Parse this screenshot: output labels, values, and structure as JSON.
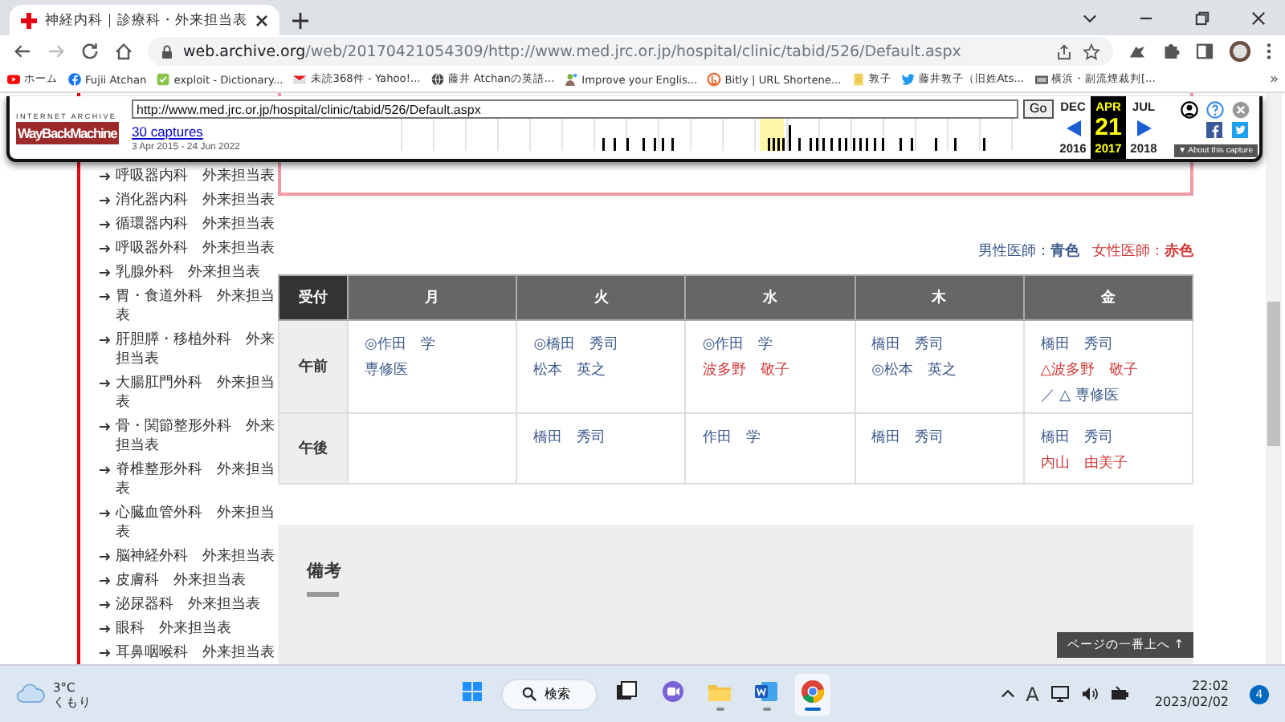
{
  "browser": {
    "tab": {
      "title": "神経内科｜診療科・外来担当表"
    },
    "address": {
      "host": "web.archive.org",
      "path": "/web/20170421054309/http://www.med.jrc.or.jp/hospital/clinic/tabid/526/Default.aspx"
    },
    "bookmarks": [
      {
        "kind": "youtube",
        "label": "ホーム"
      },
      {
        "kind": "facebook",
        "label": "Fujii Atchan"
      },
      {
        "kind": "check",
        "label": "exploit - Dictionary..."
      },
      {
        "kind": "mail",
        "label": "未読368件 - Yahoo!..."
      },
      {
        "kind": "globe",
        "label": "藤井 Atchanの英語..."
      },
      {
        "kind": "person",
        "label": "Improve your Englis..."
      },
      {
        "kind": "bitly",
        "label": "Bitly | URL Shortene..."
      },
      {
        "kind": "folder",
        "label": "敦子"
      },
      {
        "kind": "twitter",
        "label": "藤井敦子（旧姓Ats..."
      },
      {
        "kind": "image",
        "label": "横浜・副流煙裁判[..."
      }
    ],
    "bookmarks_more": "»"
  },
  "wayback": {
    "brand_top": "INTERNET ARCHIVE",
    "brand": "WayBackMachine",
    "url": "http://www.med.jrc.or.jp/hospital/clinic/tabid/526/Default.aspx",
    "go": "Go",
    "captures": "30 captures",
    "range": "3 Apr 2015 - 24 Jun 2022",
    "calendar": [
      {
        "month": "DEC",
        "year": "2016",
        "selected": false
      },
      {
        "month": "APR",
        "day": "21",
        "year": "2017",
        "selected": true
      },
      {
        "month": "JUL",
        "year": "2018",
        "selected": false
      }
    ],
    "about": "▼ About this capture"
  },
  "sidebar": {
    "items": [
      "呼吸器内科　外来担当表",
      "消化器内科　外来担当表",
      "循環器内科　外来担当表",
      "呼吸器外科　外来担当表",
      "乳腺外科　外来担当表",
      "胃・食道外科　外来担当表",
      "肝胆膵・移植外科　外来担当表",
      "大腸肛門外科　外来担当表",
      "骨・関節整形外科　外来担当表",
      "脊椎整形外科　外来担当表",
      "心臓血管外科　外来担当表",
      "脳神経外科　外来担当表",
      "皮膚科　外来担当表",
      "泌尿器科　外来担当表",
      "眼科　外来担当表",
      "耳鼻咽喉科　外来担当表"
    ]
  },
  "legend": [
    {
      "text": "男性医師：**青色**",
      "color": "#3c5a8c"
    },
    {
      "text": "女性医師：**赤色**",
      "color": "#d03a3a"
    }
  ],
  "schedule": {
    "corner": "受付",
    "columns": [
      "月",
      "火",
      "水",
      "木",
      "金"
    ],
    "rows": [
      {
        "label": "午前",
        "cells": [
          {
            "doctors": [
              {
                "name": "◎作田　学",
                "color": "#3c5a8c"
              },
              {
                "name": "専修医",
                "color": "#3c5a8c"
              }
            ]
          },
          {
            "doctors": [
              {
                "name": "◎橋田　秀司",
                "color": "#3c5a8c"
              },
              {
                "name": "松本　英之",
                "color": "#3c5a8c"
              }
            ]
          },
          {
            "doctors": [
              {
                "name": "◎作田　学",
                "color": "#3c5a8c"
              },
              {
                "name": "波多野　敬子",
                "color": "#d03a3a"
              }
            ]
          },
          {
            "doctors": [
              {
                "name": "橋田　秀司",
                "color": "#3c5a8c"
              },
              {
                "name": "◎松本　英之",
                "color": "#3c5a8c"
              }
            ]
          },
          {
            "doctors": [
              {
                "name": "橋田　秀司",
                "color": "#3c5a8c"
              },
              {
                "name": "△波多野　敬子",
                "color": "#d03a3a"
              },
              {
                "name": "／ △ 専修医",
                "color": "#3c5a8c"
              }
            ]
          }
        ]
      },
      {
        "label": "午後",
        "cells": [
          {},
          {
            "doctors": [
              {
                "name": "橋田　秀司",
                "color": "#3c5a8c"
              }
            ]
          },
          {
            "doctors": [
              {
                "name": "作田　学",
                "color": "#3c5a8c"
              }
            ]
          },
          {
            "doctors": [
              {
                "name": "橋田　秀司",
                "color": "#3c5a8c"
              }
            ]
          },
          {
            "doctors": [
              {
                "name": "橋田　秀司",
                "color": "#3c5a8c"
              },
              {
                "name": "内山　由美子",
                "color": "#d03a3a"
              }
            ]
          }
        ]
      }
    ]
  },
  "notes": {
    "title": "備考"
  },
  "back_to_top": "ページの一番上へ ↑",
  "taskbar": {
    "temperature": "3°C",
    "weather": "くもり",
    "search": "検索",
    "apps": [
      {
        "kind": "windows",
        "running": false,
        "selected": false
      },
      {
        "kind": "taskview",
        "running": false,
        "selected": false
      },
      {
        "kind": "chat",
        "running": false,
        "selected": false
      },
      {
        "kind": "explorer",
        "running": true,
        "selected": false
      },
      {
        "kind": "word",
        "running": true,
        "selected": false
      },
      {
        "kind": "chrome",
        "running": true,
        "selected": true
      }
    ],
    "ime": "A",
    "time": "22:02",
    "date": "2023/02/02",
    "badge": "4"
  }
}
